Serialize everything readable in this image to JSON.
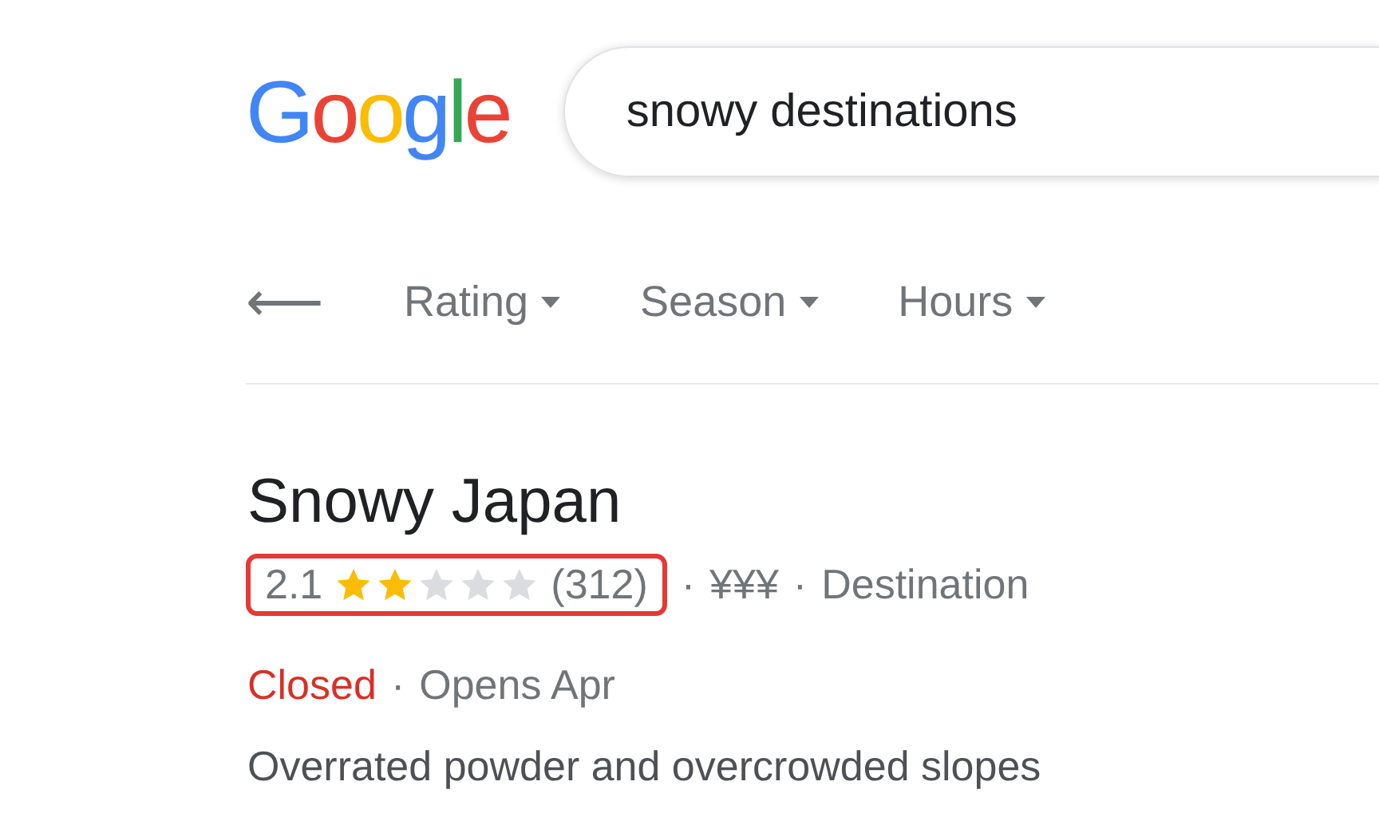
{
  "logo": "Google",
  "search": {
    "value": "snowy destinations"
  },
  "filters": [
    {
      "label": "Rating"
    },
    {
      "label": "Season"
    },
    {
      "label": "Hours"
    }
  ],
  "back": "⟵",
  "result": {
    "title": "Snowy Japan",
    "rating": "2.1",
    "stars": 2,
    "reviews": "(312)",
    "rating_highlighted": true,
    "separators": [
      "·",
      "·",
      "·"
    ],
    "price": "¥¥¥",
    "category": "Destination",
    "status": "Closed",
    "hours": "Opens Apr",
    "description": "Overrated powder and overcrowded slopes"
  }
}
